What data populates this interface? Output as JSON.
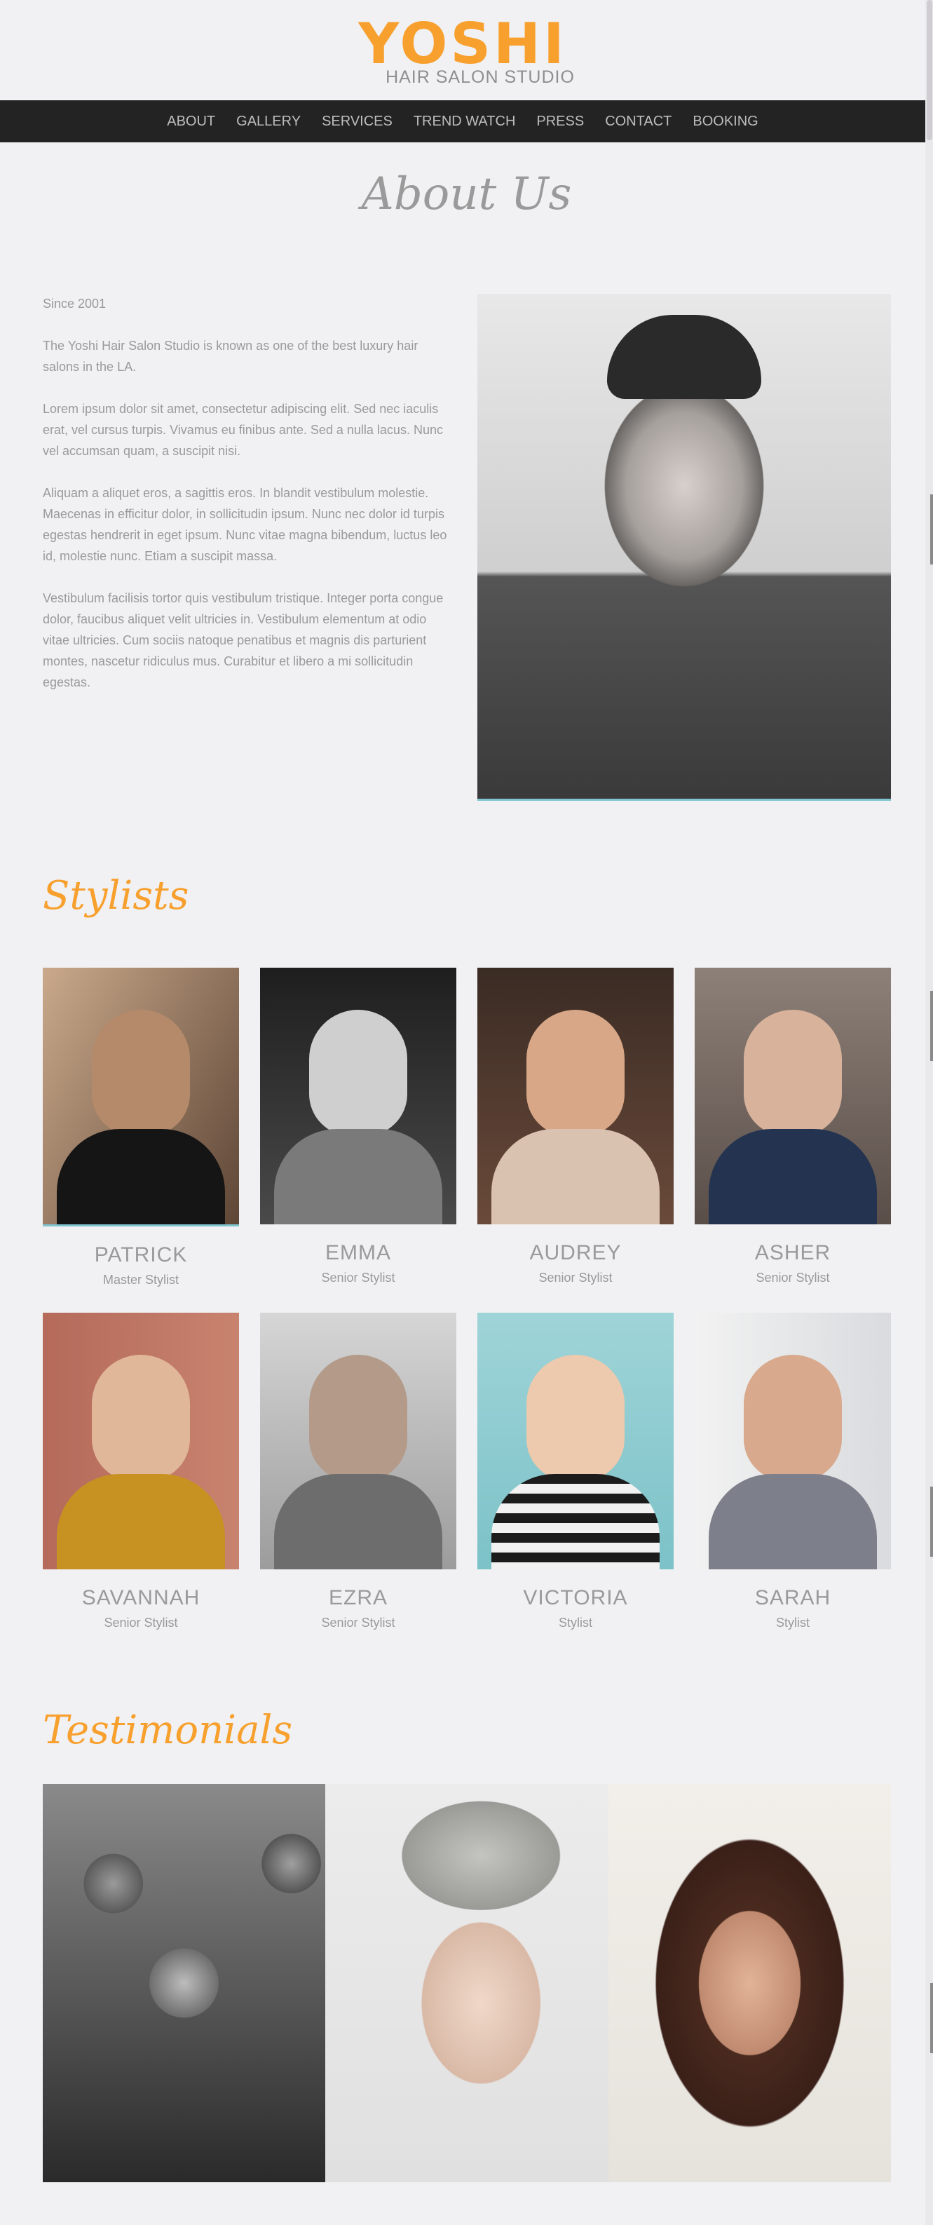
{
  "logo": {
    "brand": "YOSHI",
    "tagline": "HAIR SALON STUDIO"
  },
  "nav": {
    "items": [
      "ABOUT",
      "GALLERY",
      "SERVICES",
      "TREND WATCH",
      "PRESS",
      "CONTACT",
      "BOOKING"
    ]
  },
  "about": {
    "title": "About Us",
    "paragraphs": [
      "Since 2001",
      "The Yoshi Hair Salon Studio is known as one of the best luxury hair salons in the LA.",
      "Lorem ipsum dolor sit amet, consectetur adipiscing elit. Sed nec iaculis erat, vel cursus turpis. Vivamus eu finibus ante. Sed a nulla lacus. Nunc vel accumsan quam, a suscipit nisi.",
      "Aliquam a aliquet eros, a sagittis eros. In blandit vestibulum molestie. Maecenas in efficitur dolor, in sollicitudin ipsum. Nunc nec dolor id turpis egestas hendrerit in eget ipsum. Nunc vitae magna bibendum, luctus leo id, molestie nunc. Etiam a suscipit massa.",
      "Vestibulum facilisis tortor quis vestibulum tristique. Integer porta congue dolor, faucibus aliquet velit ultricies in. Vestibulum elementum at odio vitae ultricies. Cum sociis natoque penatibus et magnis dis parturient montes, nascetur ridiculus mus. Curabitur et libero a mi sollicitudin egestas."
    ]
  },
  "stylists": {
    "title": "Stylists",
    "items": [
      {
        "name": "PATRICK",
        "role": "Master Stylist"
      },
      {
        "name": "EMMA",
        "role": "Senior Stylist"
      },
      {
        "name": "AUDREY",
        "role": "Senior Stylist"
      },
      {
        "name": "ASHER",
        "role": "Senior Stylist"
      },
      {
        "name": "SAVANNAH",
        "role": "Senior Stylist"
      },
      {
        "name": "EZRA",
        "role": "Senior Stylist"
      },
      {
        "name": "VICTORIA",
        "role": "Stylist"
      },
      {
        "name": "SARAH",
        "role": "Stylist"
      }
    ]
  },
  "testimonials": {
    "title": "Testimonials"
  },
  "colors": {
    "accent": "#f7a02d",
    "nav_bg": "#232323",
    "page_bg": "#f1f0f3",
    "highlight": "#7fc6d0"
  }
}
